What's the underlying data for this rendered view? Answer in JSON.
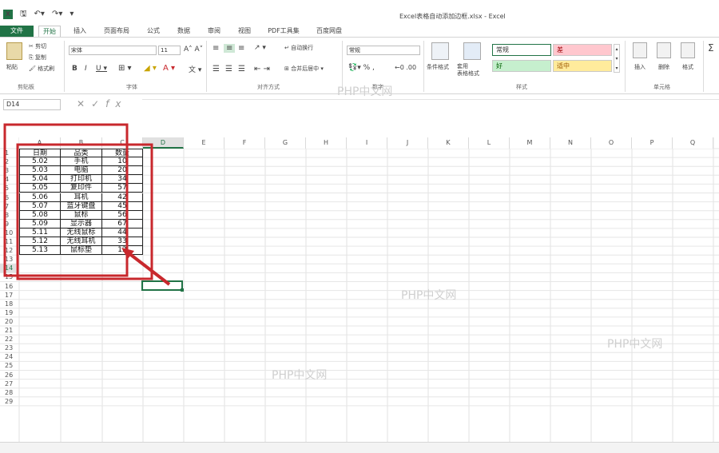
{
  "titlebar": {
    "title": "Excel表格自动添加边框.xlsx - Excel"
  },
  "tabs": [
    "文件",
    "开始",
    "插入",
    "页面布局",
    "公式",
    "数据",
    "审阅",
    "视图",
    "PDF工具集",
    "百度网盘"
  ],
  "ribbon": {
    "paste": "粘贴",
    "cut": "剪切",
    "copy": "复制",
    "format_painter": "格式刷",
    "clipboard_label": "剪贴板",
    "font_name": "宋体",
    "font_size": "11",
    "font_label": "字体",
    "wrap_text": "自动换行",
    "merge_center": "合并后居中",
    "align_label": "对齐方式",
    "number_format": "常规",
    "number_label": "数字",
    "cond_format": "条件格式",
    "table_format": "套用\n表格格式",
    "styles": {
      "normal": "常规",
      "bad": "差",
      "good": "好",
      "neutral": "适中"
    },
    "styles_label": "样式",
    "insert": "插入",
    "delete": "删除",
    "format": "格式",
    "cells_label": "单元格"
  },
  "formula_bar": {
    "name_box": "D14",
    "formula": ""
  },
  "columns": [
    "A",
    "B",
    "C",
    "D",
    "E",
    "F",
    "G",
    "H",
    "I",
    "J",
    "K",
    "L",
    "M",
    "N",
    "O",
    "P",
    "Q"
  ],
  "rows": [
    "1",
    "2",
    "3",
    "4",
    "5",
    "6",
    "7",
    "8",
    "9",
    "10",
    "11",
    "12",
    "13",
    "14",
    "15",
    "16",
    "17",
    "18",
    "19",
    "20",
    "21",
    "22",
    "23",
    "24",
    "25",
    "26",
    "27",
    "28",
    "29"
  ],
  "table": [
    [
      "日期",
      "品类",
      "数量"
    ],
    [
      "5.02",
      "手机",
      "10"
    ],
    [
      "5.03",
      "电脑",
      "20"
    ],
    [
      "5.04",
      "打印机",
      "34"
    ],
    [
      "5.05",
      "复印件",
      "57"
    ],
    [
      "5.06",
      "耳机",
      "42"
    ],
    [
      "5.07",
      "蓝牙键盘",
      "45"
    ],
    [
      "5.08",
      "鼠标",
      "56"
    ],
    [
      "5.09",
      "显示器",
      "67"
    ],
    [
      "5.11",
      "无线鼠标",
      "44"
    ],
    [
      "5.12",
      "无线耳机",
      "33"
    ],
    [
      "5.13",
      "鼠标垫",
      "12"
    ]
  ],
  "watermark": "PHP中文网",
  "colors": {
    "excel_green": "#217346",
    "annotation_red": "#c8282d",
    "bad_fill": "#ffc7ce",
    "good_fill": "#c6efce",
    "neutral_fill": "#ffeb9c"
  }
}
